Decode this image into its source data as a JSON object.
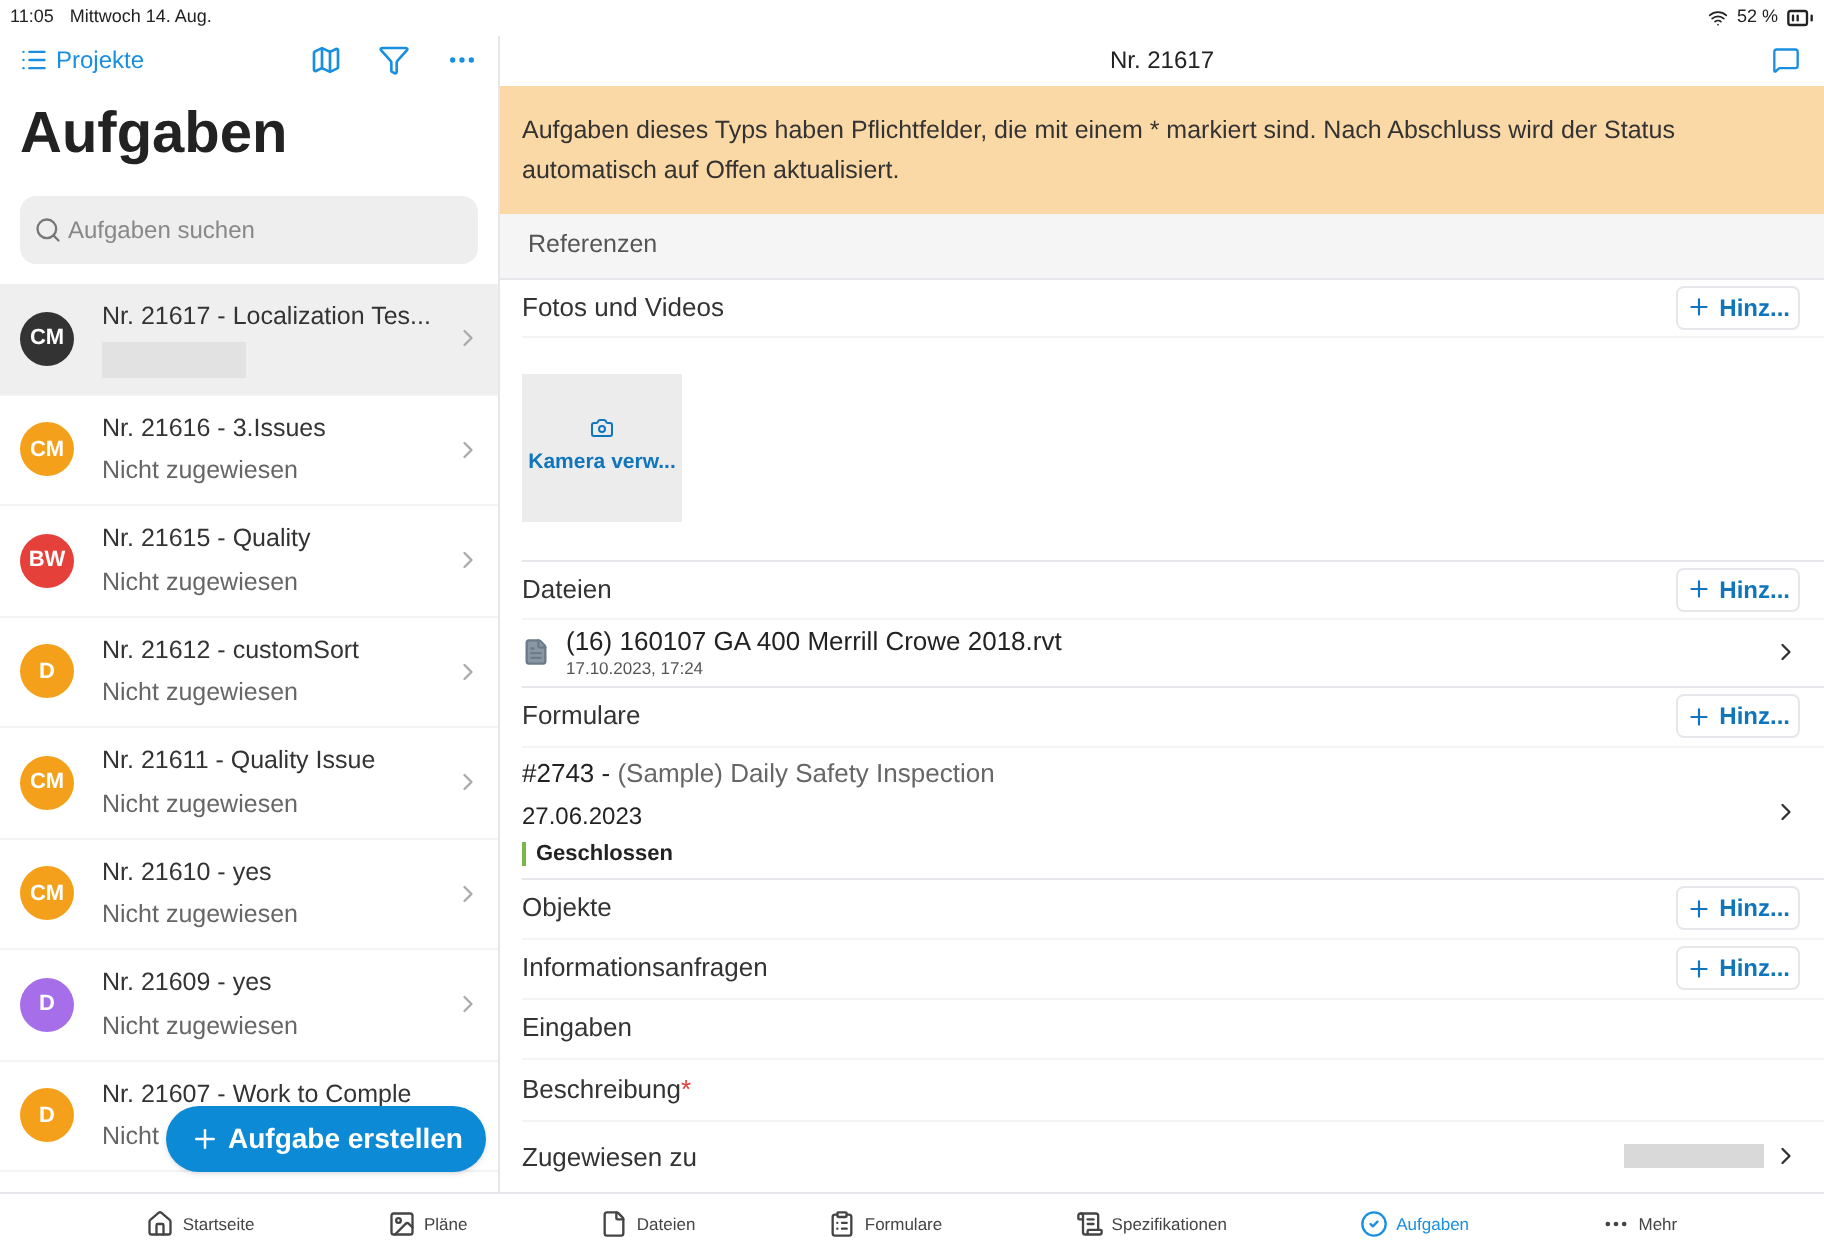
{
  "status_bar": {
    "time": "11:05",
    "date": "Mittwoch 14. Aug.",
    "battery": "52 %"
  },
  "sidebar": {
    "back_link": "Projekte",
    "title": "Aufgaben",
    "search": {
      "placeholder": "Aufgaben suchen"
    },
    "tasks": [
      {
        "initials": "CM",
        "color": "#333333",
        "title": "Nr. 21617  -  Localization Tes...",
        "selected": true
      },
      {
        "initials": "CM",
        "color": "#f5a01a",
        "title": "Nr. 21616  -  3.Issues",
        "subtitle": "Nicht zugewiesen",
        "selected": false
      },
      {
        "initials": "BW",
        "color": "#e5413a",
        "title": "Nr. 21615  -  Quality",
        "subtitle": "Nicht zugewiesen",
        "selected": false
      },
      {
        "initials": "D",
        "color": "#f5a01a",
        "title": "Nr. 21612  -  customSort",
        "subtitle": "Nicht zugewiesen",
        "selected": false
      },
      {
        "initials": "CM",
        "color": "#f5a01a",
        "title": "Nr. 21611  -  Quality Issue",
        "subtitle": "Nicht zugewiesen",
        "selected": false
      },
      {
        "initials": "CM",
        "color": "#f5a01a",
        "title": "Nr. 21610  -  yes",
        "subtitle": "Nicht zugewiesen",
        "selected": false
      },
      {
        "initials": "D",
        "color": "#a66ee8",
        "title": "Nr. 21609  -  yes",
        "subtitle": "Nicht zugewiesen",
        "selected": false
      },
      {
        "initials": "D",
        "color": "#f5a01a",
        "title": "Nr. 21607  -  Work to Comple",
        "subtitle": "Nicht",
        "selected": false
      }
    ],
    "fab": {
      "label": "Aufgabe erstellen"
    }
  },
  "detail": {
    "title": "Nr. 21617",
    "banner": "Aufgaben dieses Typs haben Pflichtfelder, die mit einem * markiert sind. Nach Abschluss wird der Status automatisch auf Offen aktualisiert.",
    "section_header": "Referenzen",
    "sections": [
      {
        "kind": "photos",
        "label": "Fotos und Videos",
        "add_label": "Hinz...",
        "tile_label": "Kamera verw..."
      },
      {
        "kind": "files",
        "label": "Dateien",
        "add_label": "Hinz...",
        "items": [
          {
            "name": "(16) 160107 GA 400 Merrill Crowe 2018.rvt",
            "date": "17.10.2023, 17:24"
          }
        ]
      },
      {
        "kind": "forms",
        "label": "Formulare",
        "add_label": "Hinz...",
        "items": [
          {
            "number": "#2743 -",
            "title": "(Sample) Daily Safety Inspection",
            "date": "27.06.2023",
            "status": "Geschlossen",
            "color": "#7ab648"
          }
        ]
      },
      {
        "kind": "simple",
        "label": "Objekte",
        "add_label": "Hinz..."
      },
      {
        "kind": "simple",
        "label": "Informationsanfragen",
        "add_label": "Hinz..."
      },
      {
        "kind": "simple",
        "label": "Eingaben"
      },
      {
        "kind": "field",
        "label": "Beschreibung",
        "required_marker": "*"
      },
      {
        "kind": "assignee",
        "label": "Zugewiesen zu"
      }
    ]
  },
  "tabs": [
    {
      "label": "Startseite",
      "selected": false
    },
    {
      "label": "Pläne",
      "selected": false
    },
    {
      "label": "Dateien",
      "selected": false
    },
    {
      "label": "Formulare",
      "selected": false
    },
    {
      "label": "Spezifikationen",
      "selected": false
    },
    {
      "label": "Aufgaben",
      "selected": true
    },
    {
      "label": "Mehr",
      "selected": false
    }
  ]
}
